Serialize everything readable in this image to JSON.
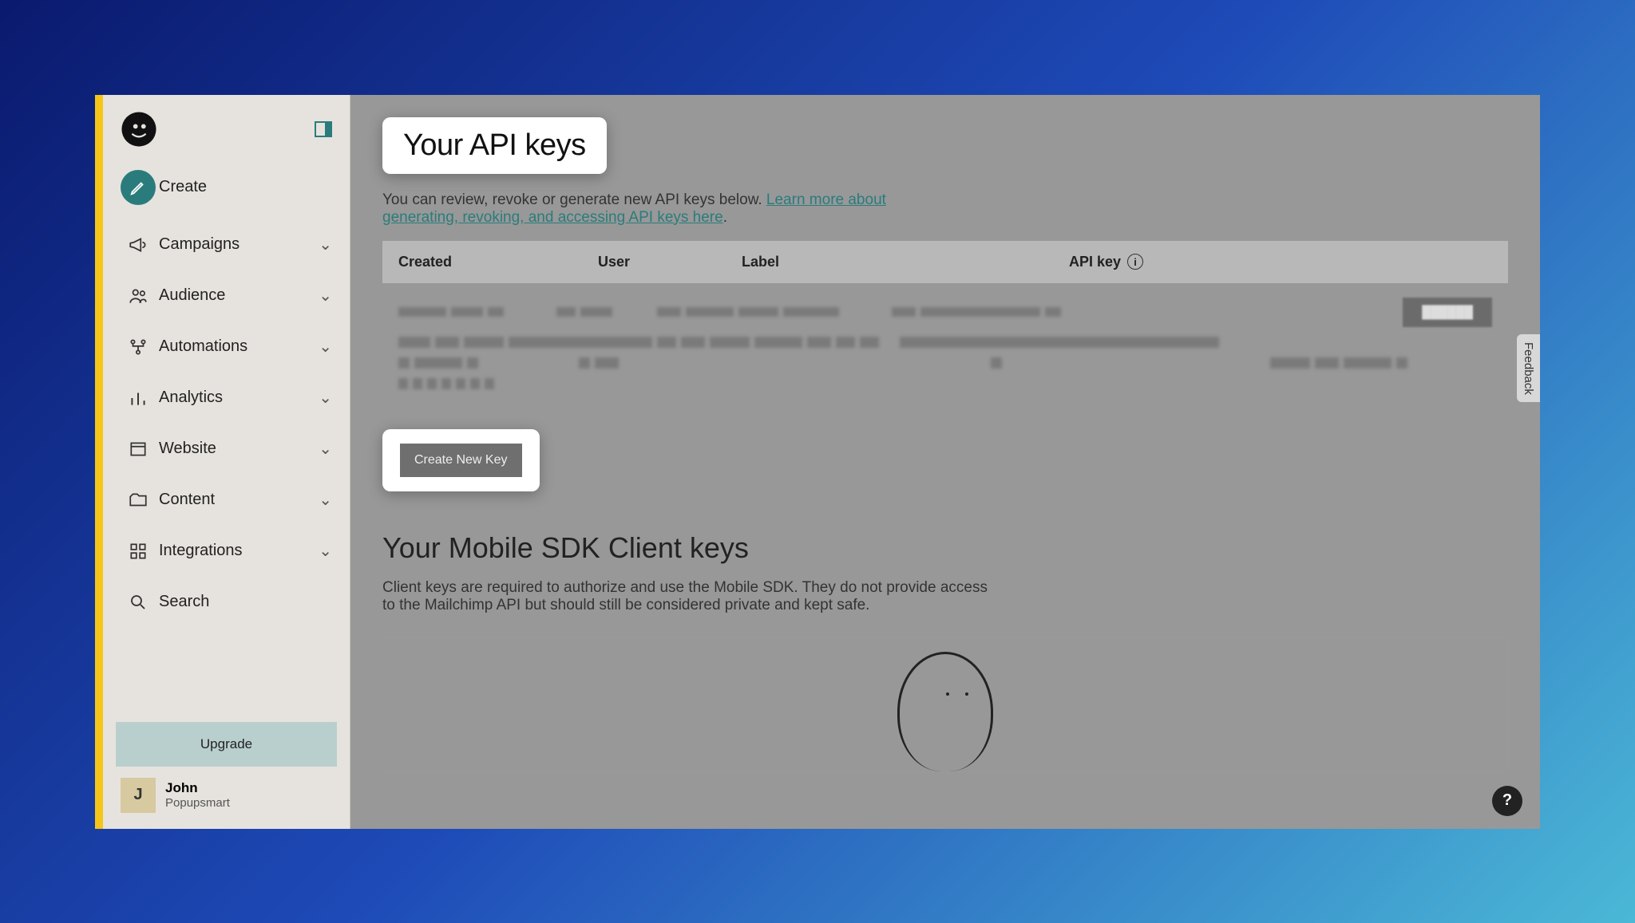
{
  "sidebar": {
    "items": [
      {
        "id": "create",
        "label": "Create",
        "expandable": false
      },
      {
        "id": "campaigns",
        "label": "Campaigns",
        "expandable": true
      },
      {
        "id": "audience",
        "label": "Audience",
        "expandable": true
      },
      {
        "id": "automations",
        "label": "Automations",
        "expandable": true
      },
      {
        "id": "analytics",
        "label": "Analytics",
        "expandable": true
      },
      {
        "id": "website",
        "label": "Website",
        "expandable": true
      },
      {
        "id": "content",
        "label": "Content",
        "expandable": true
      },
      {
        "id": "integrations",
        "label": "Integrations",
        "expandable": true
      },
      {
        "id": "search",
        "label": "Search",
        "expandable": false
      }
    ],
    "upgrade_label": "Upgrade",
    "user": {
      "initial": "J",
      "name": "John",
      "org": "Popupsmart"
    }
  },
  "main": {
    "title": "Your API keys",
    "description_prefix": "You can review, revoke or generate new API keys below. ",
    "description_link": "Learn more about generating, revoking, and accessing API keys here",
    "description_suffix": ".",
    "table": {
      "headers": {
        "created": "Created",
        "user": "User",
        "label": "Label",
        "api_key": "API key"
      }
    },
    "create_key_label": "Create New Key",
    "sdk_title": "Your Mobile SDK Client keys",
    "sdk_description": "Client keys are required to authorize and use the Mobile SDK. They do not provide access to the Mailchimp API but should still be considered private and kept safe."
  },
  "feedback_label": "Feedback",
  "help_label": "?"
}
